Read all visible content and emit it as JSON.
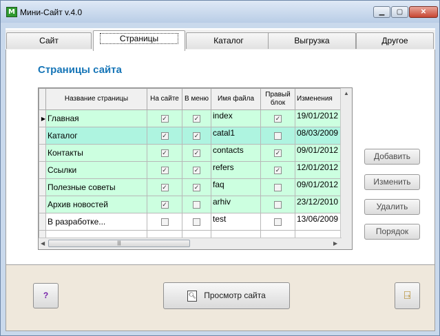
{
  "window": {
    "title": "Мини-Сайт v.4.0",
    "icon_letter": "M"
  },
  "tabs": [
    {
      "label": "Сайт"
    },
    {
      "label": "Страницы"
    },
    {
      "label": "Каталог"
    },
    {
      "label": "Выгрузка"
    },
    {
      "label": "Другое"
    }
  ],
  "active_tab": "Страницы",
  "heading": "Страницы сайта",
  "grid": {
    "columns": {
      "name": "Название страницы",
      "on_site": "На сайте",
      "in_menu": "В меню",
      "file": "Имя файла",
      "right_block": "Правый блок",
      "changed": "Изменения"
    },
    "rows": [
      {
        "name": "Главная",
        "on_site": true,
        "in_menu": true,
        "file": "index",
        "right_block": true,
        "changed": "19/01/2012",
        "current": true
      },
      {
        "name": "Каталог",
        "on_site": true,
        "in_menu": true,
        "file": "catal1",
        "right_block": false,
        "changed": "08/03/2009"
      },
      {
        "name": "Контакты",
        "on_site": true,
        "in_menu": true,
        "file": "contacts",
        "right_block": true,
        "changed": "09/01/2012"
      },
      {
        "name": "Ссылки",
        "on_site": true,
        "in_menu": true,
        "file": "refers",
        "right_block": true,
        "changed": "12/01/2012"
      },
      {
        "name": "Полезные советы",
        "on_site": true,
        "in_menu": true,
        "file": "faq",
        "right_block": false,
        "changed": "09/01/2012"
      },
      {
        "name": "Архив новостей",
        "on_site": true,
        "in_menu": false,
        "file": "arhiv",
        "right_block": false,
        "changed": "23/12/2010"
      },
      {
        "name": "В разработке...",
        "on_site": false,
        "in_menu": false,
        "file": "test",
        "right_block": false,
        "changed": "13/06/2009"
      }
    ]
  },
  "buttons": {
    "add": "Добавить",
    "edit": "Изменить",
    "delete": "Удалить",
    "order": "Порядок",
    "help": "?",
    "view_site": "Просмотр сайта"
  },
  "icons": {
    "app": "app-m-icon",
    "help": "question-mark",
    "view_site": "magnifier-page-icon",
    "exit": "exit-door-icon"
  },
  "colors": {
    "heading": "#1675b7",
    "row_green": "#ccffe0",
    "row_teal": "#aef4e0",
    "bottom_panel": "#efe8dc"
  }
}
